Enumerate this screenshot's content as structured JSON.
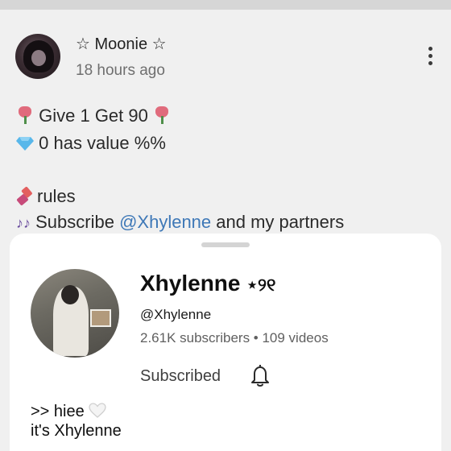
{
  "post": {
    "author_name": "☆ Moonie ☆",
    "time": "18 hours ago",
    "line1_text": "Give 1 Get 90",
    "line2_text": "0 has value %%",
    "line3_text": "rules",
    "line4_prefix": "Subscribe ",
    "line4_mention": "@Xhylenne",
    "line4_suffix": "  and my partners"
  },
  "channel": {
    "name": "Xhylenne",
    "name_deco": "⋆୨୧",
    "handle": "@Xhylenne",
    "stats": "2.61K subscribers • 109 videos",
    "subscribed_label": "Subscribed",
    "desc_line1": ">> hiee",
    "desc_line2": "it's Xhylenne"
  },
  "colors": {
    "mention": "#3e78b7",
    "sheet_bg": "#ffffff",
    "dimmed_bg": "#f0f0f0"
  },
  "icons": {
    "more": "more-vert-icon",
    "bell": "bell-icon",
    "tulip": "tulip-icon",
    "gem": "gem-icon",
    "lipstick": "lipstick-icon",
    "notes": "music-notes-icon",
    "heart": "white-heart-icon"
  }
}
